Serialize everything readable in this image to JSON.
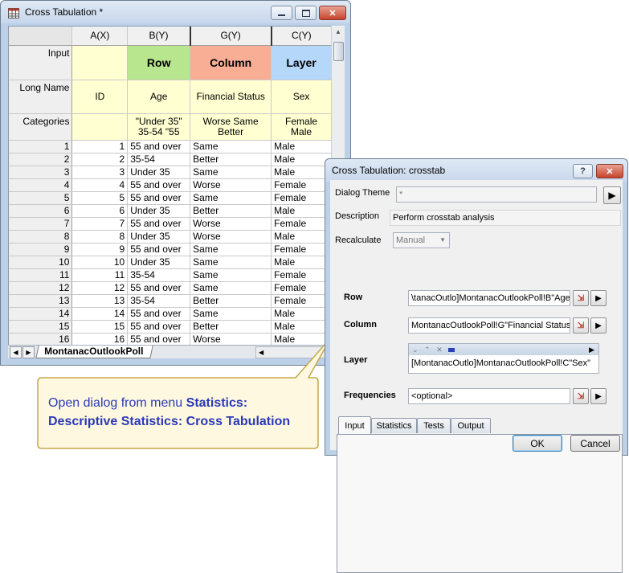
{
  "worksheet": {
    "title": "Cross Tabulation *",
    "columns": [
      {
        "header": "A(X)",
        "input": "",
        "long_name": "ID",
        "categories": ""
      },
      {
        "header": "B(Y)",
        "input": "Row",
        "long_name": "Age",
        "categories": "\"Under 35\" 35-54 \"55"
      },
      {
        "header": "G(Y)",
        "input": "Column",
        "long_name": "Financial Status",
        "categories": "Worse Same Better"
      },
      {
        "header": "C(Y)",
        "input": "Layer",
        "long_name": "Sex",
        "categories": "Female Male"
      }
    ],
    "row_labels": {
      "input": "Input",
      "long_name": "Long Name",
      "categories": "Categories"
    },
    "rows": [
      [
        "1",
        "1",
        "55 and over",
        "Same",
        "Male"
      ],
      [
        "2",
        "2",
        "35-54",
        "Better",
        "Male"
      ],
      [
        "3",
        "3",
        "Under 35",
        "Same",
        "Male"
      ],
      [
        "4",
        "4",
        "55 and over",
        "Worse",
        "Female"
      ],
      [
        "5",
        "5",
        "55 and over",
        "Same",
        "Female"
      ],
      [
        "6",
        "6",
        "Under 35",
        "Better",
        "Male"
      ],
      [
        "7",
        "7",
        "55 and over",
        "Worse",
        "Female"
      ],
      [
        "8",
        "8",
        "Under 35",
        "Worse",
        "Male"
      ],
      [
        "9",
        "9",
        "55 and over",
        "Same",
        "Female"
      ],
      [
        "10",
        "10",
        "Under 35",
        "Same",
        "Male"
      ],
      [
        "11",
        "11",
        "35-54",
        "Same",
        "Female"
      ],
      [
        "12",
        "12",
        "55 and over",
        "Same",
        "Female"
      ],
      [
        "13",
        "13",
        "35-54",
        "Better",
        "Female"
      ],
      [
        "14",
        "14",
        "55 and over",
        "Same",
        "Male"
      ],
      [
        "15",
        "15",
        "55 and over",
        "Better",
        "Male"
      ],
      [
        "16",
        "16",
        "55 and over",
        "Worse",
        "Male"
      ]
    ],
    "sheet_tab": "MontanacOutlookPoll",
    "colors": {
      "row": "#b7e68e",
      "column": "#f7ae95",
      "layer": "#b5d7f9"
    }
  },
  "callout": {
    "text_plain": "Open dialog from menu ",
    "text_bold_1": "Statistics:",
    "text_bold_2": "Descriptive Statistics: Cross Tabulation"
  },
  "dialog": {
    "title": "Cross Tabulation: crosstab",
    "help": "?",
    "theme_label": "Dialog Theme",
    "theme_value": "*",
    "description_label": "Description",
    "description_value": "Perform crosstab analysis",
    "recalculate_label": "Recalculate",
    "recalculate_value": "Manual",
    "tabs": [
      "Input",
      "Statistics",
      "Tests",
      "Output"
    ],
    "row_label": "Row",
    "row_value": "\\tanacOutlo]MontanacOutlookPoll!B\"Age\"",
    "column_label": "Column",
    "column_value": "MontanacOutlookPoll!G\"Financial Status\"",
    "layer_label": "Layer",
    "layer_value": "[MontanacOutlo]MontanacOutlookPoll!C\"Sex\"",
    "frequencies_label": "Frequencies",
    "frequencies_value": "<optional>",
    "ok": "OK",
    "cancel": "Cancel"
  }
}
